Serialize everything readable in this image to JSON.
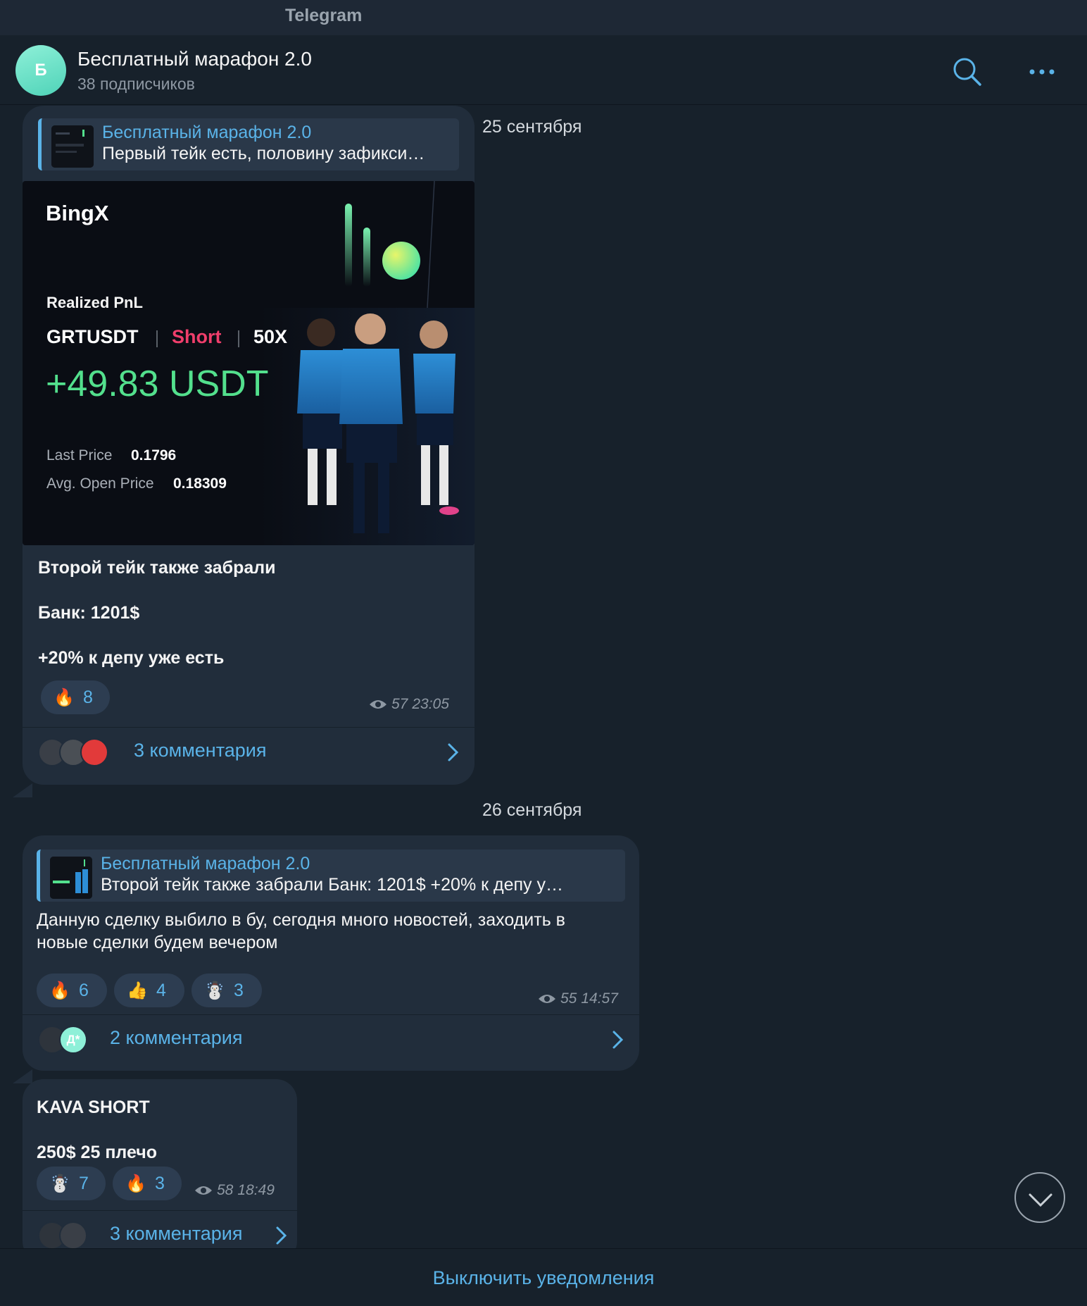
{
  "window": {
    "title": "Telegram"
  },
  "header": {
    "avatar_letter": "Б",
    "channel_name": "Бесплатный марафон 2.0",
    "subscribers": "38 подписчиков",
    "icons": [
      "search-icon",
      "more-icon"
    ]
  },
  "dates": [
    "25 сентября",
    "26 сентября"
  ],
  "messages": [
    {
      "reply": {
        "name": "Бесплатный марафон 2.0",
        "text": "Первый тейк есть, половину зафикси…"
      },
      "card": {
        "brand": "BingX",
        "label": "Realized PnL",
        "pair": "GRTUSDT",
        "side": "Short",
        "leverage": "50X",
        "pnl": "+49.83 USDT",
        "last_price_label": "Last Price",
        "last_price": "0.1796",
        "avg_open_label": "Avg. Open Price",
        "avg_open": "0.18309"
      },
      "lines": [
        "Второй тейк также забрали",
        "Банк: 1201$",
        "+20% к депу уже есть"
      ],
      "reactions": [
        {
          "emoji": "🔥",
          "count": "8"
        }
      ],
      "views": "57",
      "time": "23:05",
      "comments": "3 комментария"
    },
    {
      "reply": {
        "name": "Бесплатный марафон 2.0",
        "text": "Второй тейк также забрали  Банк: 1201$   +20% к депу у…"
      },
      "text_lines": [
        "Данную сделку выбило в бу, сегодня много новостей, заходить в",
        "новые сделки будем вечером"
      ],
      "reactions": [
        {
          "emoji": "🔥",
          "count": "6"
        },
        {
          "emoji": "👍",
          "count": "4"
        },
        {
          "emoji": "☃️",
          "count": "3"
        }
      ],
      "views": "55",
      "time": "14:57",
      "comments_avatar_letter": "Д*",
      "comments": "2 комментария"
    },
    {
      "lines": [
        "KAVA SHORT",
        "250$ 25 плечо"
      ],
      "reactions": [
        {
          "emoji": "☃️",
          "count": "7"
        },
        {
          "emoji": "🔥",
          "count": "3"
        }
      ],
      "views": "58",
      "time": "18:49",
      "comments": "3 комментария"
    }
  ],
  "footer": {
    "button": "Выключить уведомления"
  },
  "colors": {
    "accent": "#5ab3e8",
    "bg": "#17212b",
    "bubble": "#212d3b",
    "pnl": "#53e08d",
    "short": "#ef3e6b"
  }
}
